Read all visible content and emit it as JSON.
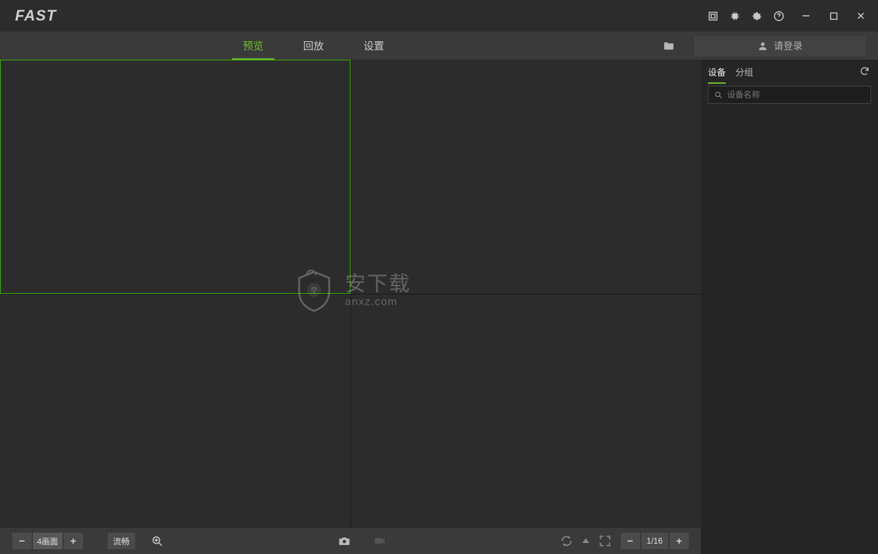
{
  "app": {
    "logo_text": "FAST"
  },
  "tabs": {
    "preview": "预览",
    "playback": "回放",
    "settings": "设置"
  },
  "login": {
    "label": "请登录"
  },
  "sidebar": {
    "tab_device": "设备",
    "tab_group": "分组",
    "search_placeholder": "设备名称"
  },
  "bottombar": {
    "layout_label": "4画面",
    "stream_label": "流畅",
    "page_label": "1/16"
  },
  "watermark": {
    "cn": "安下载",
    "en": "anxz.com"
  }
}
